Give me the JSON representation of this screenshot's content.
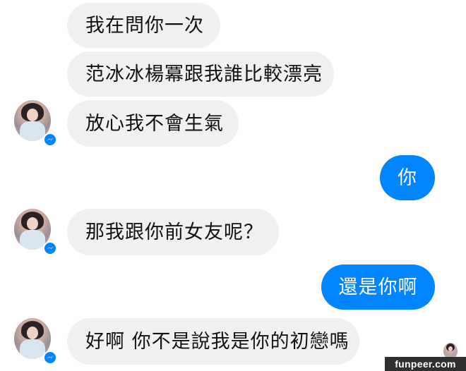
{
  "conversation": {
    "messages": [
      {
        "sender": "them",
        "text": "我在問你一次"
      },
      {
        "sender": "them",
        "text": "范冰冰楊冪跟我誰比較漂亮"
      },
      {
        "sender": "them",
        "text": "放心我不會生氣"
      },
      {
        "sender": "me",
        "text": "你"
      },
      {
        "sender": "them",
        "text": "那我跟你前女友呢？"
      },
      {
        "sender": "me",
        "text": "還是你啊"
      },
      {
        "sender": "them",
        "text": "好啊 你不是說我是你的初戀嗎"
      }
    ]
  },
  "icons": {
    "contact_avatar": "contact-avatar-icon",
    "messenger_badge": "messenger-badge-icon",
    "read_receipt": "read-receipt-avatar-icon"
  },
  "colors": {
    "incoming_bubble": "#f1f0f0",
    "outgoing_bubble": "#0084ff",
    "messenger_blue": "#0084ff"
  },
  "watermark": {
    "text": "funpeer.com"
  }
}
